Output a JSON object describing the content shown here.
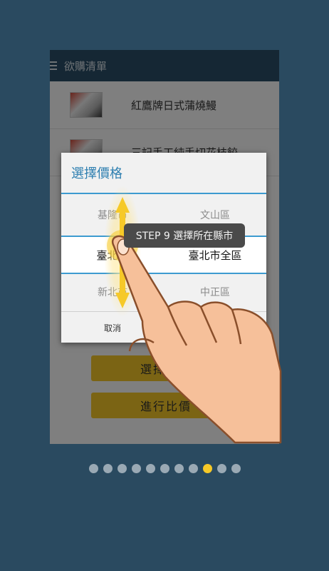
{
  "app": {
    "title": "欲購清單"
  },
  "list": {
    "items": [
      {
        "name": "紅鷹牌日式蒲燒鰻"
      },
      {
        "name": "三記手工純手切花枝餃"
      }
    ]
  },
  "buttons": {
    "select_price": "選擇價格",
    "compare": "進行比價"
  },
  "dialog": {
    "title": "選擇價格",
    "rows": [
      {
        "city": "基隆市",
        "district": "文山區"
      },
      {
        "city": "臺北市",
        "district": "臺北市全區"
      },
      {
        "city": "新北市",
        "district": "中正區"
      }
    ],
    "cancel": "取消"
  },
  "tooltip": {
    "text": "STEP 9  選擇所在縣市"
  },
  "pagination": {
    "total": 11,
    "active_index": 8
  },
  "colors": {
    "background": "#2a4a60",
    "accent": "#f6c928",
    "dialog_title": "#2e7fb0"
  },
  "icons": {
    "menu": "menu-icon",
    "hand": "pointing-hand-icon",
    "scroll": "scroll-arrows-icon"
  }
}
